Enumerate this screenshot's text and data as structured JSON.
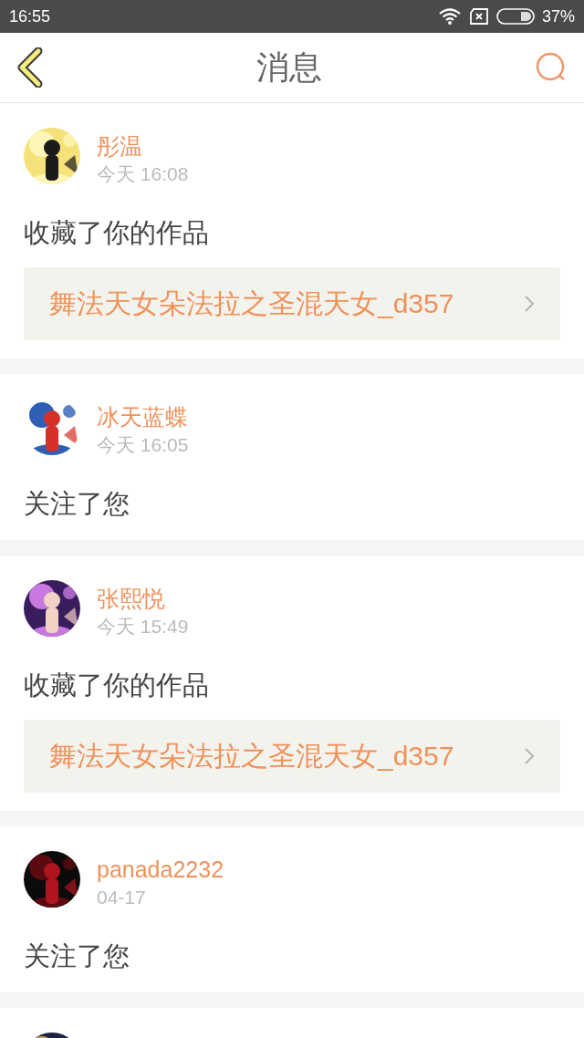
{
  "status_bar": {
    "time": "16:55",
    "battery": "37%"
  },
  "header": {
    "title": "消息"
  },
  "messages": [
    {
      "kind": "message",
      "name": "彤温",
      "time": "今天 16:08",
      "action": "收藏了你的作品",
      "link": "舞法天女朵法拉之圣混天女_d357"
    },
    {
      "kind": "message",
      "name": "冰天蓝蝶",
      "time": "今天 16:05",
      "action": "关注了您"
    },
    {
      "kind": "message",
      "name": "张熙悦",
      "time": "今天 15:49",
      "action": "收藏了你的作品",
      "link": "舞法天女朵法拉之圣混天女_d357"
    },
    {
      "kind": "message",
      "name": "panada2232",
      "time": "04-17",
      "action": "关注了您"
    },
    {
      "kind": "cut_off"
    }
  ]
}
